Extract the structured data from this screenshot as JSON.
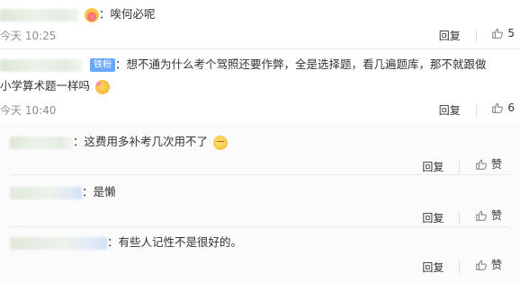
{
  "comments": [
    {
      "text": "唉何必呢",
      "time": "今天 10:25",
      "reply_label": "回复",
      "like_count": "5"
    },
    {
      "badge": "铁粉",
      "text_line1": "想不通为什么考个驾照还要作弊，全是选择题，看几遍题库，那不就跟做",
      "text_line2": "小学算术题一样吗",
      "time": "今天 10:40",
      "reply_label": "回复",
      "like_count": "6"
    }
  ],
  "replies": [
    {
      "text": "这费用多补考几次用不了",
      "reply_label": "回复",
      "like_label": "赞"
    },
    {
      "text": "是懒",
      "reply_label": "回复",
      "like_label": "赞"
    },
    {
      "text": "有些人记性不是很好的。",
      "reply_label": "回复",
      "like_label": "赞"
    }
  ],
  "colors": {
    "text": "#333333",
    "muted": "#8f8f8f",
    "badge": "#6aa7ff",
    "divider": "#e8e8e8"
  }
}
